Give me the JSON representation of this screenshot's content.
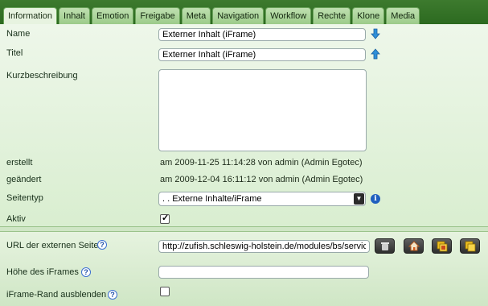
{
  "tabs": [
    {
      "label": "Information",
      "active": true
    },
    {
      "label": "Inhalt",
      "active": false
    },
    {
      "label": "Emotion",
      "active": false
    },
    {
      "label": "Freigabe",
      "active": false
    },
    {
      "label": "Meta",
      "active": false
    },
    {
      "label": "Navigation",
      "active": false
    },
    {
      "label": "Workflow",
      "active": false
    },
    {
      "label": "Rechte",
      "active": false
    },
    {
      "label": "Klone",
      "active": false
    },
    {
      "label": "Media",
      "active": false
    }
  ],
  "form": {
    "name_label": "Name",
    "name_value": "Externer Inhalt (iFrame)",
    "titel_label": "Titel",
    "titel_value": "Externer Inhalt (iFrame)",
    "kurzbeschreibung_label": "Kurzbeschreibung",
    "kurzbeschreibung_value": "",
    "erstellt_label": "erstellt",
    "erstellt_value": "am 2009-11-25 11:14:28 von admin (Admin Egotec)",
    "geaendert_label": "geändert",
    "geaendert_value": "am 2009-12-04 16:11:12 von admin (Admin Egotec)",
    "seitentyp_label": "Seitentyp",
    "seitentyp_value": ". . Externe Inhalte/iFrame",
    "aktiv_label": "Aktiv",
    "aktiv_checked": true
  },
  "extra": {
    "url_label": "URL der externen Seite",
    "url_value": "http://zufish.schleswig-holstein.de/modules/bs/service",
    "hoehe_label": "Höhe des iFrames",
    "hoehe_value": "",
    "rand_label": "iFrame-Rand ausblenden",
    "rand_checked": false
  },
  "icons": {
    "help_glyph": "?",
    "info_glyph": "i",
    "accent": "#2c6a20",
    "panel": "#e7f3e0"
  }
}
